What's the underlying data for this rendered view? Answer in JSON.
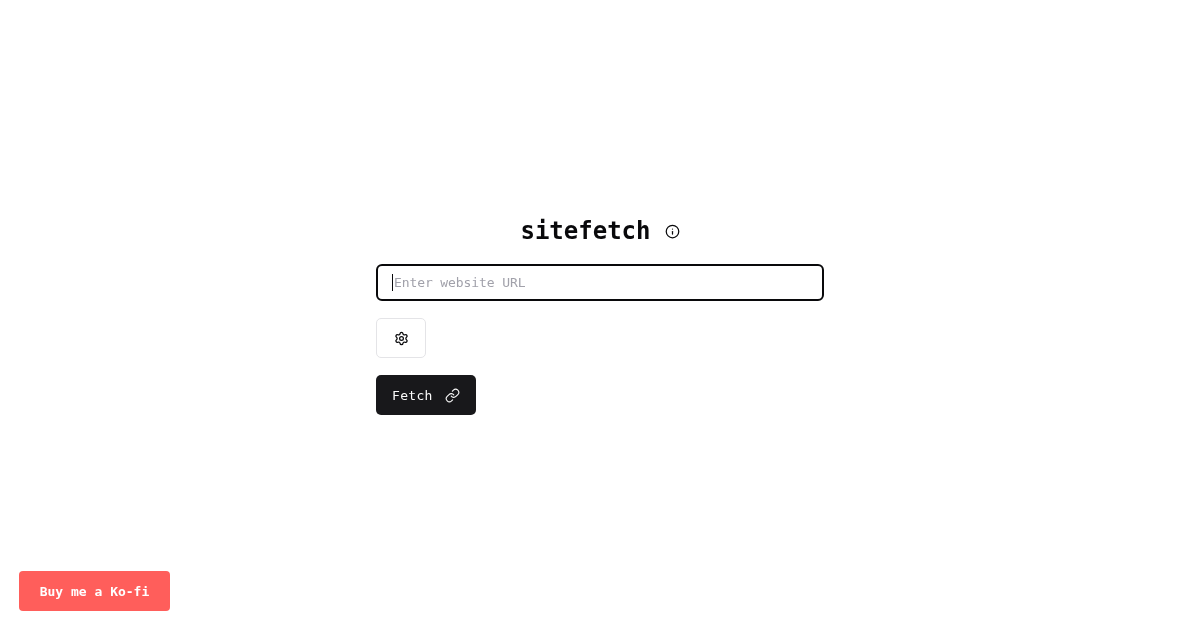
{
  "title": "sitefetch",
  "url_field": {
    "placeholder": "Enter website URL",
    "focused": true
  },
  "fetch_button": {
    "label": "Fetch"
  },
  "kofi_button": {
    "label": "Buy me a Ko-fi"
  }
}
